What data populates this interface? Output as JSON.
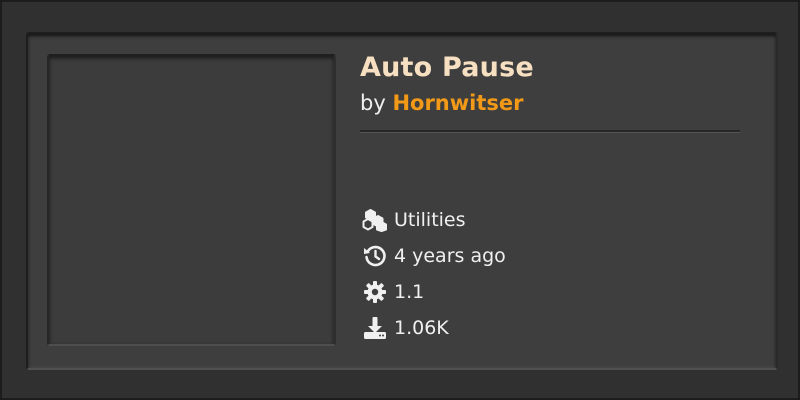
{
  "mod": {
    "title": "Auto Pause",
    "by_prefix": "by",
    "author": "Hornwitser"
  },
  "meta": {
    "category": "Utilities",
    "updated": "4 years ago",
    "version": "1.1",
    "downloads": "1.06K"
  },
  "icons": {
    "category": "cubes-icon",
    "updated": "history-icon",
    "version": "gear-icon",
    "downloads": "download-icon"
  },
  "colors": {
    "title": "#f7dfc1",
    "author": "#f29a17",
    "text": "#f0f0f0",
    "panel": "#3e3e3e"
  }
}
